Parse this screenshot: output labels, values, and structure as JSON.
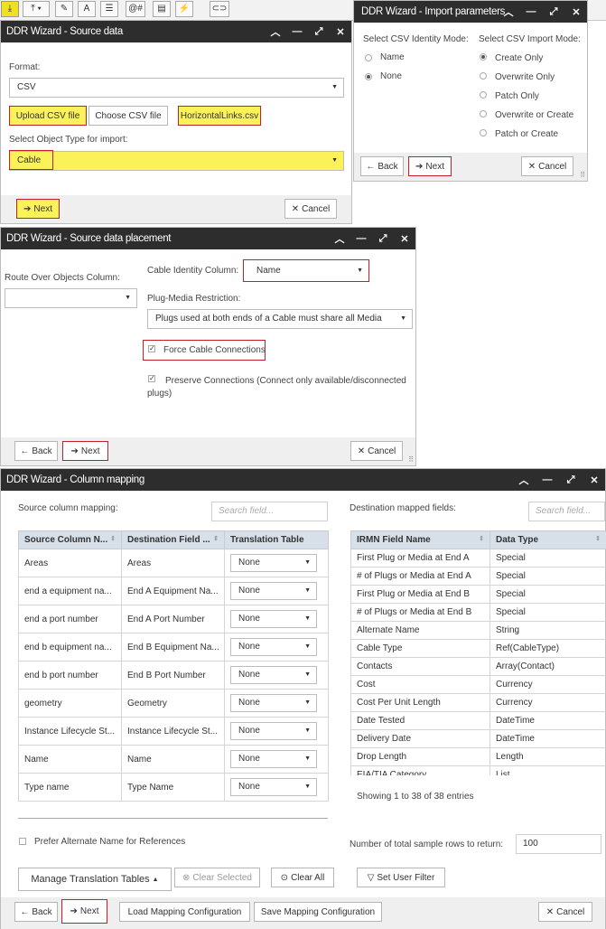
{
  "toolbar": {
    "buttons": [
      {
        "icon": "import-icon",
        "glyph": "⤓",
        "active": true
      },
      {
        "icon": "export-icon",
        "glyph": "⤒ ▾"
      },
      {
        "icon": "edit-icon",
        "glyph": "✎"
      },
      {
        "icon": "text-icon",
        "glyph": "A"
      },
      {
        "icon": "list-icon",
        "glyph": "☰"
      },
      {
        "icon": "at-hash-icon",
        "glyph": "@#"
      },
      {
        "icon": "form-icon",
        "glyph": "▤"
      },
      {
        "icon": "plug-icon",
        "glyph": "⚡"
      },
      {
        "icon": "link-icon",
        "glyph": "⊂⊃"
      }
    ]
  },
  "source_data": {
    "title": "DDR Wizard - Source data",
    "format_label": "Format:",
    "format_value": "CSV",
    "upload_label": "Upload CSV file",
    "choose_label": "Choose CSV file",
    "file_name": "HorizontalLinks.csv",
    "object_type_label": "Select Object Type for import:",
    "object_type_value": "Cable",
    "next_label": "Next",
    "cancel_label": "Cancel"
  },
  "import_params": {
    "title": "DDR Wizard - Import parameters",
    "identity_label": "Select CSV Identity Mode:",
    "identity_options": [
      {
        "label": "Name",
        "selected": false
      },
      {
        "label": "None",
        "selected": true
      }
    ],
    "import_mode_label": "Select CSV Import Mode:",
    "import_modes": [
      {
        "label": "Create Only",
        "selected": true
      },
      {
        "label": "Overwrite Only",
        "selected": false
      },
      {
        "label": "Patch Only",
        "selected": false
      },
      {
        "label": "Overwrite or Create",
        "selected": false
      },
      {
        "label": "Patch or Create",
        "selected": false
      }
    ],
    "back_label": "Back",
    "next_label": "Next",
    "cancel_label": "Cancel"
  },
  "placement": {
    "title": "DDR Wizard - Source data placement",
    "route_label": "Route Over Objects Column:",
    "route_value": "",
    "identity_label": "Cable Identity Column:",
    "identity_value": "Name",
    "plug_label": "Plug-Media Restriction:",
    "plug_value": "Plugs used at both ends of a Cable must share all Media",
    "force_label": "Force Cable Connections",
    "preserve_label": "Preserve Connections (Connect only available/disconnected plugs)",
    "back_label": "Back",
    "next_label": "Next",
    "cancel_label": "Cancel"
  },
  "mapping": {
    "title": "DDR Wizard - Column mapping",
    "source_label": "Source column mapping:",
    "source_search_ph": "Search field...",
    "dest_label": "Destination mapped fields:",
    "dest_search_ph": "Search field...",
    "source_headers": [
      "Source Column N...",
      "Destination Field ...",
      "Translation Table"
    ],
    "source_rows": [
      {
        "src": "Areas",
        "dst": "Areas",
        "tt": "None"
      },
      {
        "src": "end a equipment na...",
        "dst": "End A Equipment Na...",
        "tt": "None"
      },
      {
        "src": "end a port number",
        "dst": "End A Port Number",
        "tt": "None"
      },
      {
        "src": "end b equipment na...",
        "dst": "End B Equipment Na...",
        "tt": "None"
      },
      {
        "src": "end b port number",
        "dst": "End B Port Number",
        "tt": "None"
      },
      {
        "src": "geometry",
        "dst": "Geometry",
        "tt": "None"
      },
      {
        "src": "Instance Lifecycle St...",
        "dst": "Instance Lifecycle St...",
        "tt": "None"
      },
      {
        "src": "Name",
        "dst": "Name",
        "tt": "None"
      },
      {
        "src": "Type name",
        "dst": "Type Name",
        "tt": "None"
      }
    ],
    "dest_headers": [
      "IRMN Field Name",
      "Data Type"
    ],
    "dest_rows": [
      {
        "name": "First Plug or Media at End A",
        "type": "Special"
      },
      {
        "name": "# of Plugs or Media at End A",
        "type": "Special"
      },
      {
        "name": "First Plug or Media at End B",
        "type": "Special"
      },
      {
        "name": "# of Plugs or Media at End B",
        "type": "Special"
      },
      {
        "name": "Alternate Name",
        "type": "String"
      },
      {
        "name": "Cable Type",
        "type": "Ref(CableType)"
      },
      {
        "name": "Contacts",
        "type": "Array(Contact)"
      },
      {
        "name": "Cost",
        "type": "Currency"
      },
      {
        "name": "Cost Per Unit Length",
        "type": "Currency"
      },
      {
        "name": "Date Tested",
        "type": "DateTime"
      },
      {
        "name": "Delivery Date",
        "type": "DateTime"
      },
      {
        "name": "Drop Length",
        "type": "Length"
      },
      {
        "name": "EIA/TIA Category",
        "type": "List"
      }
    ],
    "showing_text": "Showing 1 to 38 of 38 entries",
    "prefer_label": "Prefer Alternate Name for References",
    "sample_label": "Number of total sample rows to return:",
    "sample_value": "100",
    "manage_label": "Manage Translation Tables",
    "clear_selected_label": "Clear Selected",
    "clear_all_label": "Clear All",
    "set_filter_label": "Set User Filter",
    "back_label": "Back",
    "next_label": "Next",
    "load_label": "Load Mapping Configuration",
    "save_label": "Save Mapping Configuration",
    "cancel_label": "Cancel"
  },
  "colors": {
    "titlebar": "#2d2d2d",
    "highlight_yellow": "#fbf25a",
    "highlight_red": "#c0202a",
    "table_header": "#d7dfe8"
  }
}
